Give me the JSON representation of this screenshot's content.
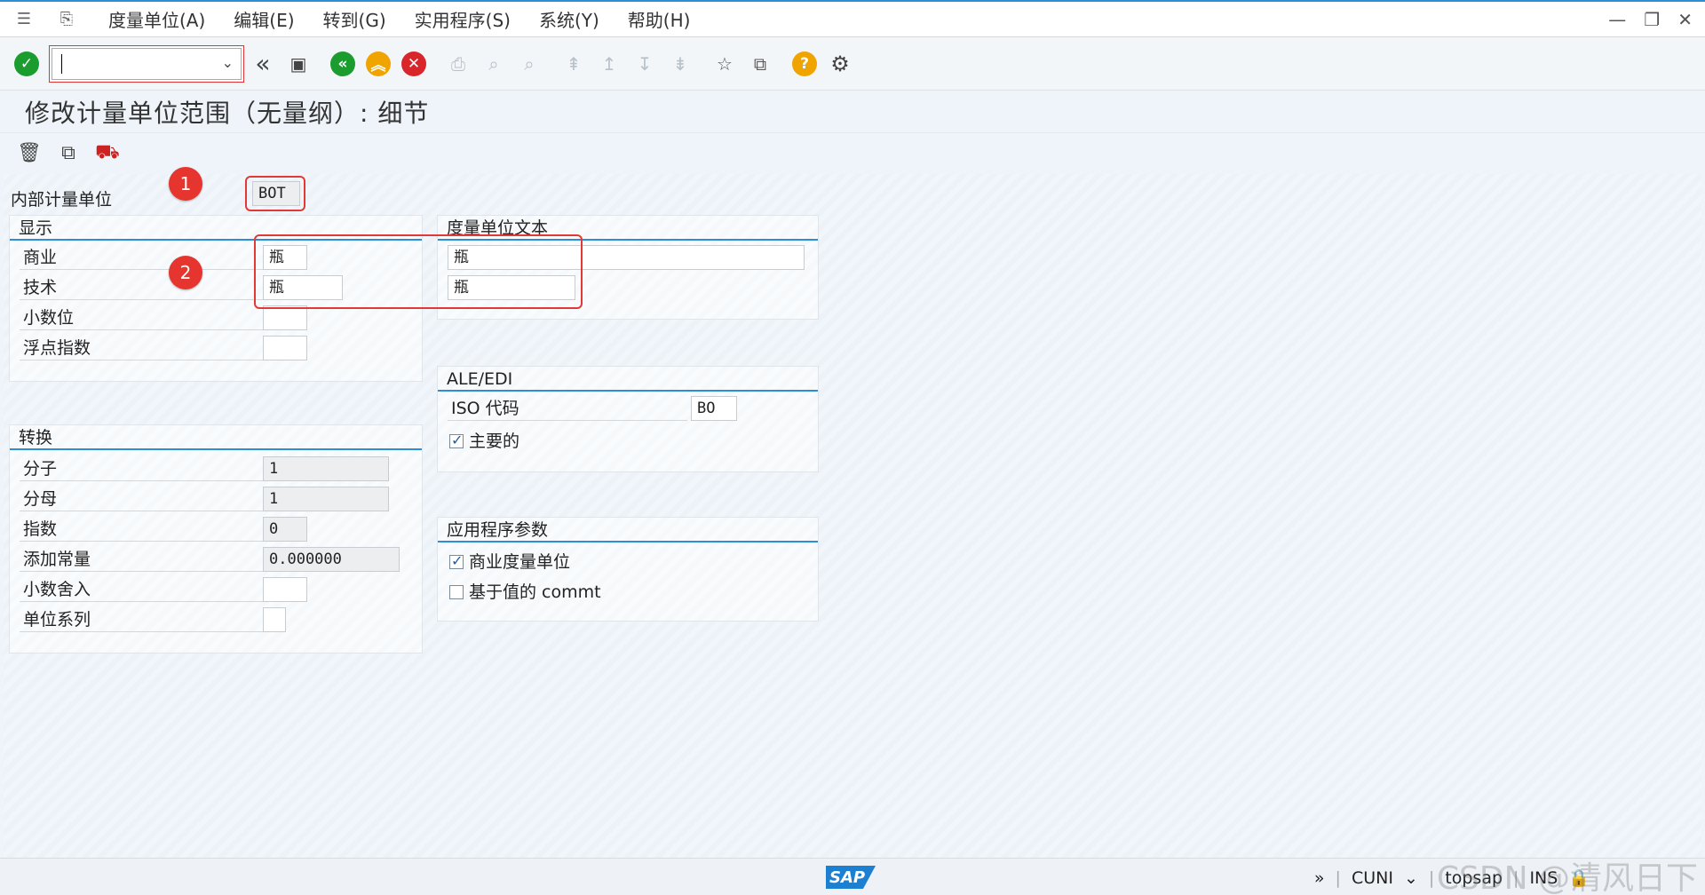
{
  "menu": {
    "items": [
      "度量单位(A)",
      "编辑(E)",
      "转到(G)",
      "实用程序(S)",
      "系统(Y)",
      "帮助(H)"
    ]
  },
  "toolbar": {
    "command_value": ""
  },
  "page_title": "修改计量单位范围（无量纲）: 细节",
  "internal_unit": {
    "label": "内部计量单位",
    "value": "BOT"
  },
  "display": {
    "header": "显示",
    "rows": [
      {
        "label": "商业",
        "value": "瓶"
      },
      {
        "label": "技术",
        "value": "瓶"
      },
      {
        "label": "小数位",
        "value": ""
      },
      {
        "label": "浮点指数",
        "value": ""
      }
    ]
  },
  "unit_text": {
    "header": "度量单位文本",
    "values": [
      "瓶",
      "瓶"
    ]
  },
  "ale_edi": {
    "header": "ALE/EDI",
    "iso_label": "ISO 代码",
    "iso_value": "BO",
    "primary_label": "主要的",
    "primary_checked": true
  },
  "conversion": {
    "header": "转换",
    "rows": [
      {
        "label": "分子",
        "value": "1"
      },
      {
        "label": "分母",
        "value": "1"
      },
      {
        "label": "指数",
        "value": "0"
      },
      {
        "label": "添加常量",
        "value": "0.000000"
      },
      {
        "label": "小数舍入",
        "value": ""
      },
      {
        "label": "单位系列",
        "value": ""
      }
    ]
  },
  "app_params": {
    "header": "应用程序参数",
    "items": [
      {
        "label": "商业度量单位",
        "checked": true
      },
      {
        "label": "基于值的 commt",
        "checked": false
      }
    ]
  },
  "annotations": [
    "1",
    "2"
  ],
  "status": {
    "transaction": "CUNI",
    "server": "topsap",
    "mode": "INS",
    "logo": "SAP"
  },
  "watermark": "CSDN @清风日下",
  "colors": {
    "accent": "#2a8fd6",
    "annotation": "#e13a36",
    "ok": "#1a9c2e"
  }
}
